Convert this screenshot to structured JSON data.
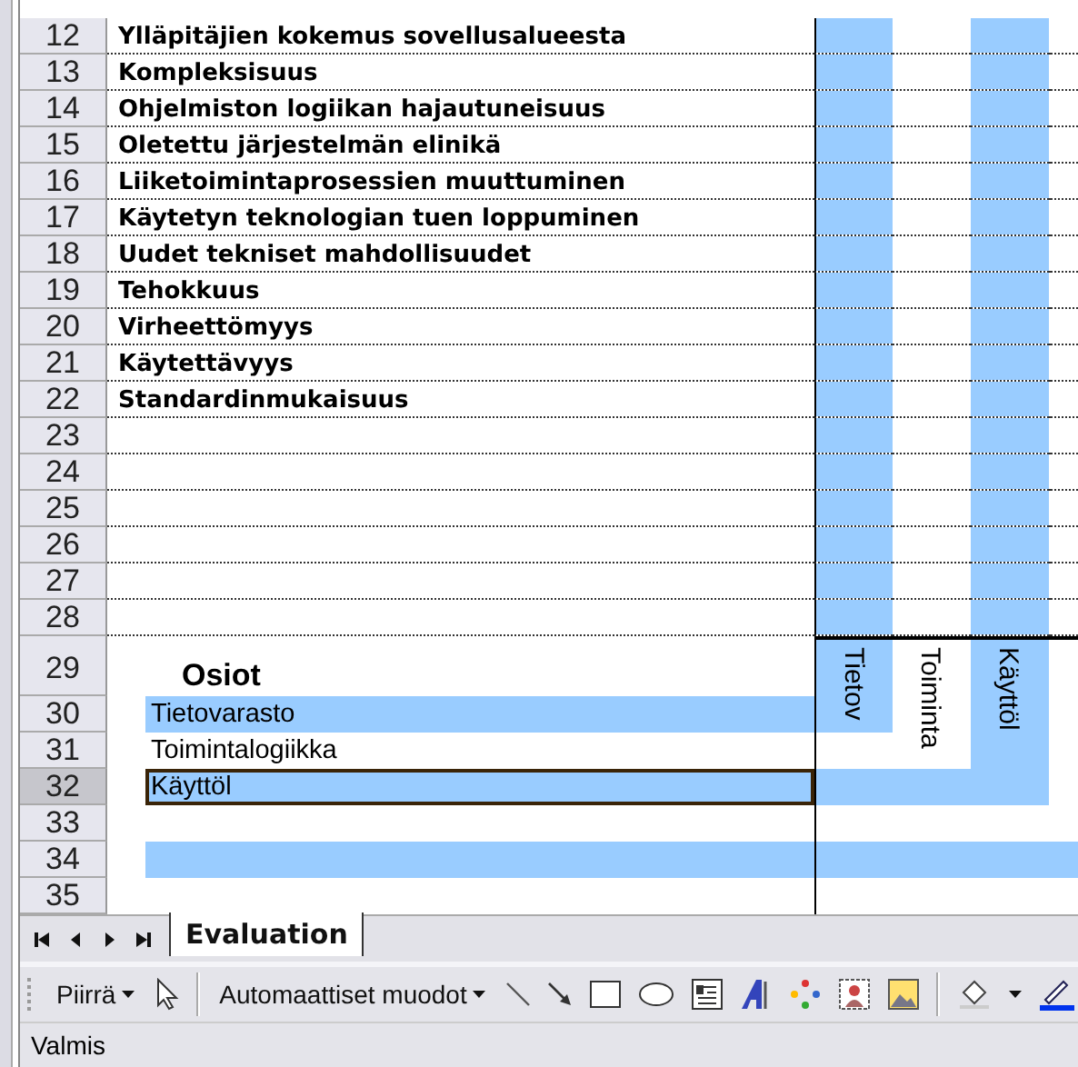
{
  "sheet": {
    "columns": [
      {
        "header": "Tietov"
      },
      {
        "header": "Toiminta"
      },
      {
        "header": "Käyttöl"
      }
    ],
    "rows": [
      {
        "number": "12",
        "kind": "criterion",
        "text": "Ylläpitäjien kokemus sovellusalueesta",
        "selected": false,
        "cells": [
          false,
          true,
          false,
          true,
          false
        ]
      },
      {
        "number": "13",
        "kind": "criterion",
        "text": "Kompleksisuus",
        "selected": false,
        "cells": [
          false,
          true,
          false,
          true,
          false
        ]
      },
      {
        "number": "14",
        "kind": "criterion",
        "text": "Ohjelmiston logiikan hajautuneisuus",
        "selected": false,
        "cells": [
          false,
          true,
          false,
          true,
          false
        ]
      },
      {
        "number": "15",
        "kind": "criterion",
        "text": "Oletettu järjestelmän elinikä",
        "selected": false,
        "cells": [
          false,
          true,
          false,
          true,
          false
        ]
      },
      {
        "number": "16",
        "kind": "criterion",
        "text": "Liiketoimintaprosessien muuttuminen",
        "selected": false,
        "cells": [
          false,
          true,
          false,
          true,
          false
        ]
      },
      {
        "number": "17",
        "kind": "criterion",
        "text": "Käytetyn teknologian tuen loppuminen",
        "selected": false,
        "cells": [
          false,
          true,
          false,
          true,
          false
        ]
      },
      {
        "number": "18",
        "kind": "criterion",
        "text": "Uudet tekniset mahdollisuudet",
        "selected": false,
        "cells": [
          false,
          true,
          false,
          true,
          false
        ]
      },
      {
        "number": "19",
        "kind": "criterion",
        "text": "Tehokkuus",
        "selected": false,
        "cells": [
          false,
          true,
          false,
          true,
          false
        ]
      },
      {
        "number": "20",
        "kind": "criterion",
        "text": "Virheettömyys",
        "selected": false,
        "cells": [
          false,
          true,
          false,
          true,
          false
        ]
      },
      {
        "number": "21",
        "kind": "criterion",
        "text": "Käytettävyys",
        "selected": false,
        "cells": [
          false,
          true,
          false,
          true,
          false
        ]
      },
      {
        "number": "22",
        "kind": "criterion",
        "text": "Standardinmukaisuus",
        "selected": false,
        "cells": [
          false,
          true,
          false,
          true,
          false
        ]
      },
      {
        "number": "23",
        "kind": "criterion",
        "selected": false,
        "cells": [
          false,
          true,
          false,
          true,
          false
        ]
      },
      {
        "number": "24",
        "kind": "criterion",
        "selected": false,
        "cells": [
          false,
          true,
          false,
          true,
          false
        ]
      },
      {
        "number": "25",
        "kind": "criterion",
        "selected": false,
        "cells": [
          false,
          true,
          false,
          true,
          false
        ]
      },
      {
        "number": "26",
        "kind": "criterion",
        "selected": false,
        "cells": [
          false,
          true,
          false,
          true,
          false
        ]
      },
      {
        "number": "27",
        "kind": "criterion",
        "selected": false,
        "cells": [
          false,
          true,
          false,
          true,
          false
        ]
      },
      {
        "number": "28",
        "kind": "criterion",
        "selected": false,
        "cells": [
          false,
          true,
          false,
          true,
          false
        ]
      },
      {
        "number": "29",
        "kind": "heading",
        "text": "Osiot",
        "selected": false,
        "cells": [
          false,
          true,
          false,
          true,
          false
        ]
      },
      {
        "number": "30",
        "kind": "item",
        "text": "Tietovarasto",
        "selected": false,
        "cells": [
          true,
          true,
          false,
          true,
          false
        ]
      },
      {
        "number": "31",
        "kind": "item",
        "text": "Toimintalogiikka",
        "selected": false,
        "cells": [
          false,
          false,
          false,
          true,
          false
        ]
      },
      {
        "number": "32",
        "kind": "item",
        "text": "Käyttöl",
        "selected": true,
        "cells": [
          true,
          true,
          true,
          true,
          false
        ]
      },
      {
        "number": "33",
        "kind": "item",
        "selected": false,
        "cells": [
          false,
          false,
          false,
          false,
          false
        ]
      },
      {
        "number": "34",
        "kind": "item",
        "selected": false,
        "cells": [
          true,
          true,
          true,
          true,
          true
        ]
      },
      {
        "number": "35",
        "kind": "item",
        "selected": false,
        "cells": [
          false,
          false,
          false,
          false,
          false
        ]
      }
    ]
  },
  "sheet_tabs": [
    {
      "label": "Evaluation",
      "selected": true
    }
  ],
  "drawing_toolbar": {
    "draw_menu": "Piirrä",
    "autoshapes_menu": "Automaattiset muodot"
  },
  "status_bar": {
    "text": "Valmis"
  }
}
